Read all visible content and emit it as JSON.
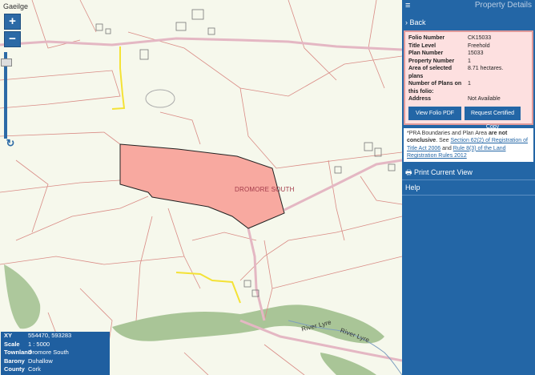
{
  "map": {
    "language_link": "Gaeilge",
    "zoom_in": "+",
    "zoom_out": "−",
    "reset_icon": "↻",
    "townland_label": "DROMORE SOUTH",
    "river_label_1": "River Lyre",
    "river_label_2": "River Lyre",
    "colors": {
      "parcel": "#f8a9a0",
      "road": "#e7b9c4",
      "track": "#f4e236",
      "woodland": "#9bbc88"
    }
  },
  "info": {
    "rows": [
      {
        "key": "XY",
        "value": "554470, 593283"
      },
      {
        "key": "Scale",
        "value": "1 : 5000"
      },
      {
        "key": "Townland",
        "value": "Dromore South"
      },
      {
        "key": "Barony",
        "value": "Duhallow"
      },
      {
        "key": "County",
        "value": "Cork"
      }
    ]
  },
  "panel": {
    "menu_icon": "≡",
    "title": "Property Details",
    "back_label": "Back",
    "details": [
      {
        "key": "Folio Number",
        "value": "CK15033"
      },
      {
        "key": "Title Level",
        "value": "Freehold"
      },
      {
        "key": "Plan Number",
        "value": "15033"
      },
      {
        "key": "Property Number",
        "value": "1"
      },
      {
        "key": "Area of selected plans",
        "value": "8.71 hectares."
      },
      {
        "key": "Number of Plans on this folio:",
        "value": "1"
      },
      {
        "key": "Address",
        "value": "Not Available"
      }
    ],
    "view_pdf": "View Folio PDF",
    "request_copy": "Request Certified Copy",
    "note": {
      "prefix": "*PRA Boundaries and Plan Area ",
      "bold": "are not conclusive",
      "mid": ". See ",
      "link1": "Section 62(2) of Registration of Title Act 2006",
      "and": " and ",
      "link2": "Rule 8(3) of the Land Registration Rules 2012"
    },
    "print_label": "Print Current View",
    "help_label": "Help",
    "colors": {
      "accent": "#2366a6",
      "card_bg": "#fde0e0",
      "card_border": "#e09a9a"
    }
  }
}
